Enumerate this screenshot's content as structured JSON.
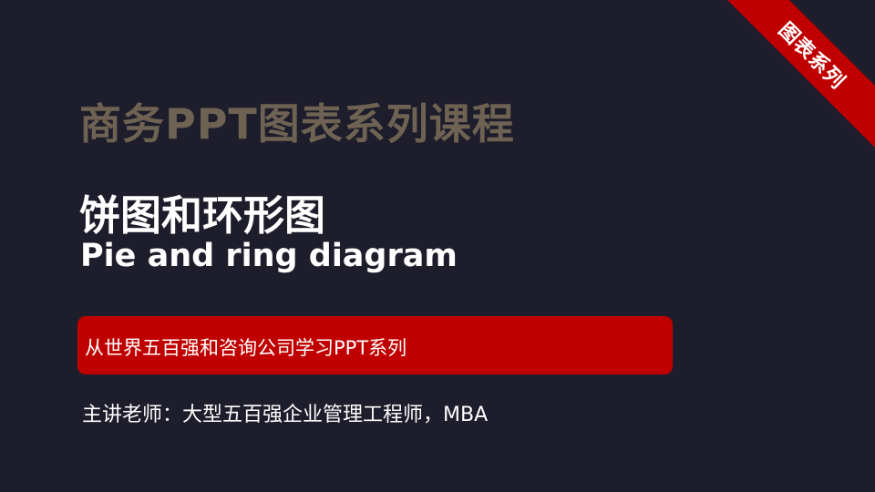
{
  "ribbon": {
    "label": "图表系列",
    "color": "#c00000"
  },
  "course": {
    "title": "商务PPT图表系列课程",
    "color": "#6e6253"
  },
  "main": {
    "title_cn": "饼图和环形图",
    "title_en": "Pie and ring diagram"
  },
  "banner": {
    "text": "从世界五百强和咨询公司学习PPT系列",
    "color": "#c00000"
  },
  "lecturer": {
    "text": "主讲老师：大型五百强企业管理工程师，MBA"
  },
  "theme": {
    "background": "#1d1d2b",
    "text_color": "#ffffff"
  }
}
